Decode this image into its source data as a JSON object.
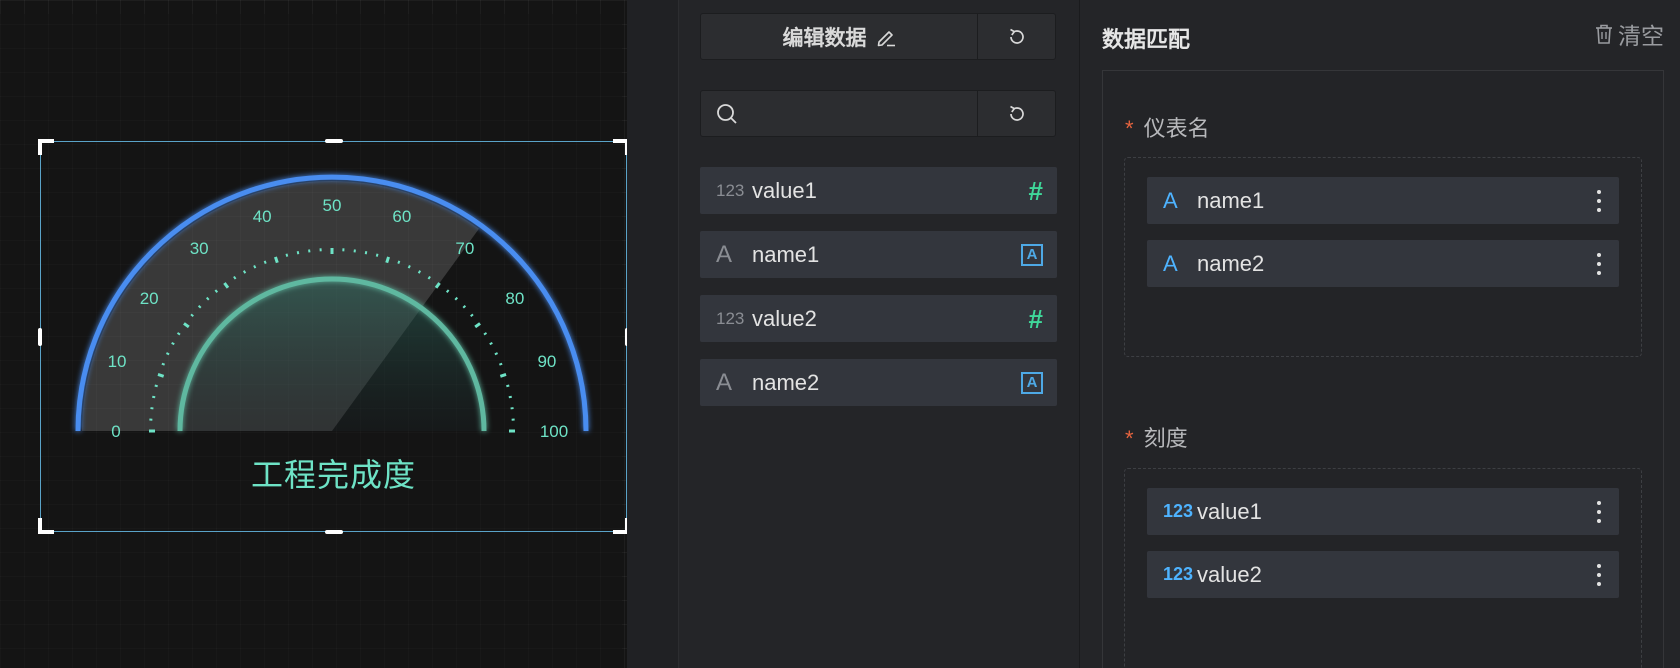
{
  "gauge": {
    "title": "工程完成度",
    "min": 0,
    "max": 100,
    "value": 70,
    "tick_labels": [
      "0",
      "10",
      "20",
      "30",
      "40",
      "50",
      "60",
      "70",
      "80",
      "90",
      "100"
    ],
    "colors": {
      "arc": "#4a8df0",
      "inner": "#5fb8a0",
      "label": "#6ee3c6"
    }
  },
  "middle": {
    "edit_label": "编辑数据",
    "search_placeholder": "",
    "fields": [
      {
        "type": "number",
        "type_label": "123",
        "name": "value1"
      },
      {
        "type": "text",
        "type_label": "A",
        "name": "name1"
      },
      {
        "type": "number",
        "type_label": "123",
        "name": "value2"
      },
      {
        "type": "text",
        "type_label": "A",
        "name": "name2"
      }
    ]
  },
  "right": {
    "title": "数据匹配",
    "clear_label": "清空",
    "sections": [
      {
        "label": "仪表名",
        "required_mark": "*",
        "chips": [
          {
            "icon": "A",
            "name": "name1"
          },
          {
            "icon": "A",
            "name": "name2"
          }
        ]
      },
      {
        "label": "刻度",
        "required_mark": "*",
        "chips": [
          {
            "icon": "123",
            "name": "value1"
          },
          {
            "icon": "123",
            "name": "value2"
          }
        ]
      }
    ]
  }
}
